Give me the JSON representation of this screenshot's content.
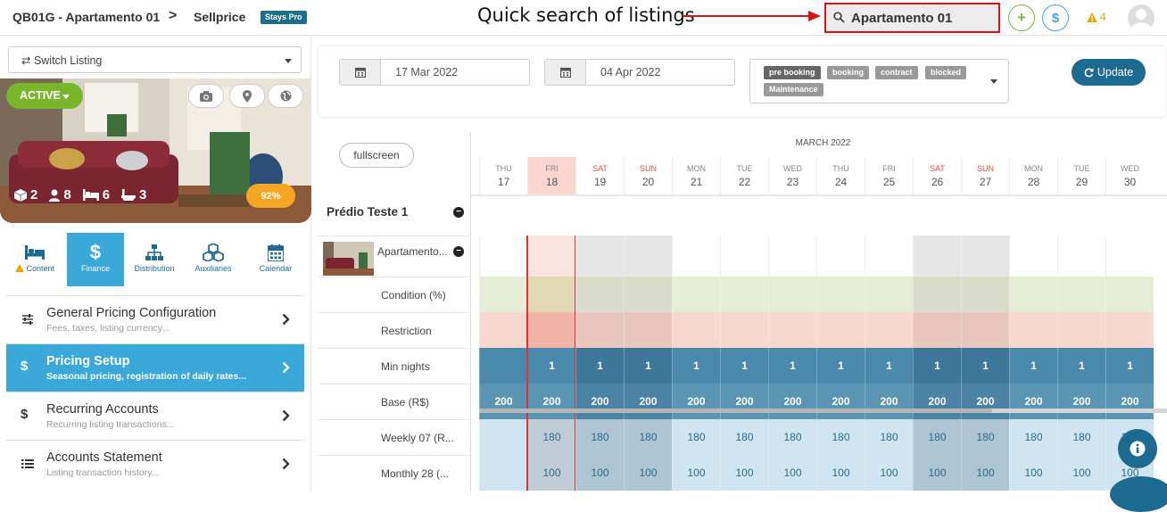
{
  "topbar": {
    "listing_code": "QB01G - Apartamento 01",
    "separator": ">",
    "section": "Sellprice",
    "plan_badge": "Stays Pro",
    "annotation": "Quick search of listings",
    "search_value": "Apartamento 01",
    "warnings_count": "4"
  },
  "sidebar": {
    "switch_listing": "⇄ Switch Listing",
    "status": "ACTIVE",
    "stats": {
      "rooms": "2",
      "guests": "8",
      "beds": "6",
      "baths": "3"
    },
    "completion": "92%",
    "tabs": [
      {
        "label": "Content"
      },
      {
        "label": "Finance"
      },
      {
        "label": "Distribution"
      },
      {
        "label": "Auxiliaries"
      },
      {
        "label": "Calendar"
      }
    ],
    "menu": [
      {
        "title": "General Pricing Configuration",
        "subtitle": "Fees, taxes, listing currency..."
      },
      {
        "title": "Pricing Setup",
        "subtitle": "Seasonal pricing, registration of daily rates..."
      },
      {
        "title": "Recurring Accounts",
        "subtitle": "Recurring listing transactions..."
      },
      {
        "title": "Accounts Statement",
        "subtitle": "Listing transaction history..."
      }
    ]
  },
  "filter": {
    "date_from": "17 Mar 2022",
    "date_to": "04 Apr 2022",
    "tags": [
      "pre booking",
      "booking",
      "contract",
      "blocked",
      "Maintenance"
    ],
    "update_label": "Update"
  },
  "calendar": {
    "fullscreen_label": "fullscreen",
    "month": "MARCH 2022",
    "days": [
      {
        "name": "THU",
        "num": "17"
      },
      {
        "name": "FRI",
        "num": "18"
      },
      {
        "name": "SAT",
        "num": "19"
      },
      {
        "name": "SUN",
        "num": "20"
      },
      {
        "name": "MON",
        "num": "21"
      },
      {
        "name": "TUE",
        "num": "22"
      },
      {
        "name": "WED",
        "num": "23"
      },
      {
        "name": "THU",
        "num": "24"
      },
      {
        "name": "FRI",
        "num": "25"
      },
      {
        "name": "SAT",
        "num": "26"
      },
      {
        "name": "SUN",
        "num": "27"
      },
      {
        "name": "MON",
        "num": "28"
      },
      {
        "name": "TUE",
        "num": "29"
      },
      {
        "name": "WED",
        "num": "30"
      }
    ],
    "group": "Prédio Teste 1",
    "unit": "Apartamento...",
    "rows": [
      {
        "label": "Condition (%)",
        "values": [
          "",
          "",
          "",
          "",
          "",
          "",
          "",
          "",
          "",
          "",
          "",
          "",
          "",
          ""
        ]
      },
      {
        "label": "Restriction",
        "values": [
          "",
          "",
          "",
          "",
          "",
          "",
          "",
          "",
          "",
          "",
          "",
          "",
          "",
          ""
        ]
      },
      {
        "label": "Min nights",
        "values": [
          "",
          "1",
          "1",
          "1",
          "1",
          "1",
          "1",
          "1",
          "1",
          "1",
          "1",
          "1",
          "1",
          "1"
        ]
      },
      {
        "label": "Base (R$)",
        "values": [
          "200",
          "200",
          "200",
          "200",
          "200",
          "200",
          "200",
          "200",
          "200",
          "200",
          "200",
          "200",
          "200",
          "200"
        ]
      },
      {
        "label": "Weekly 07 (R...",
        "values": [
          "",
          "180",
          "180",
          "180",
          "180",
          "180",
          "180",
          "180",
          "180",
          "180",
          "180",
          "180",
          "180",
          "180"
        ]
      },
      {
        "label": "Monthly 28 (...",
        "values": [
          "",
          "100",
          "100",
          "100",
          "100",
          "100",
          "100",
          "100",
          "100",
          "100",
          "100",
          "100",
          "100",
          "100"
        ]
      }
    ]
  },
  "colors": {
    "accent": "#1d6a91",
    "active": "#7ab62c",
    "highlight": "#3aa8d8",
    "annotation": "#dd1111"
  }
}
